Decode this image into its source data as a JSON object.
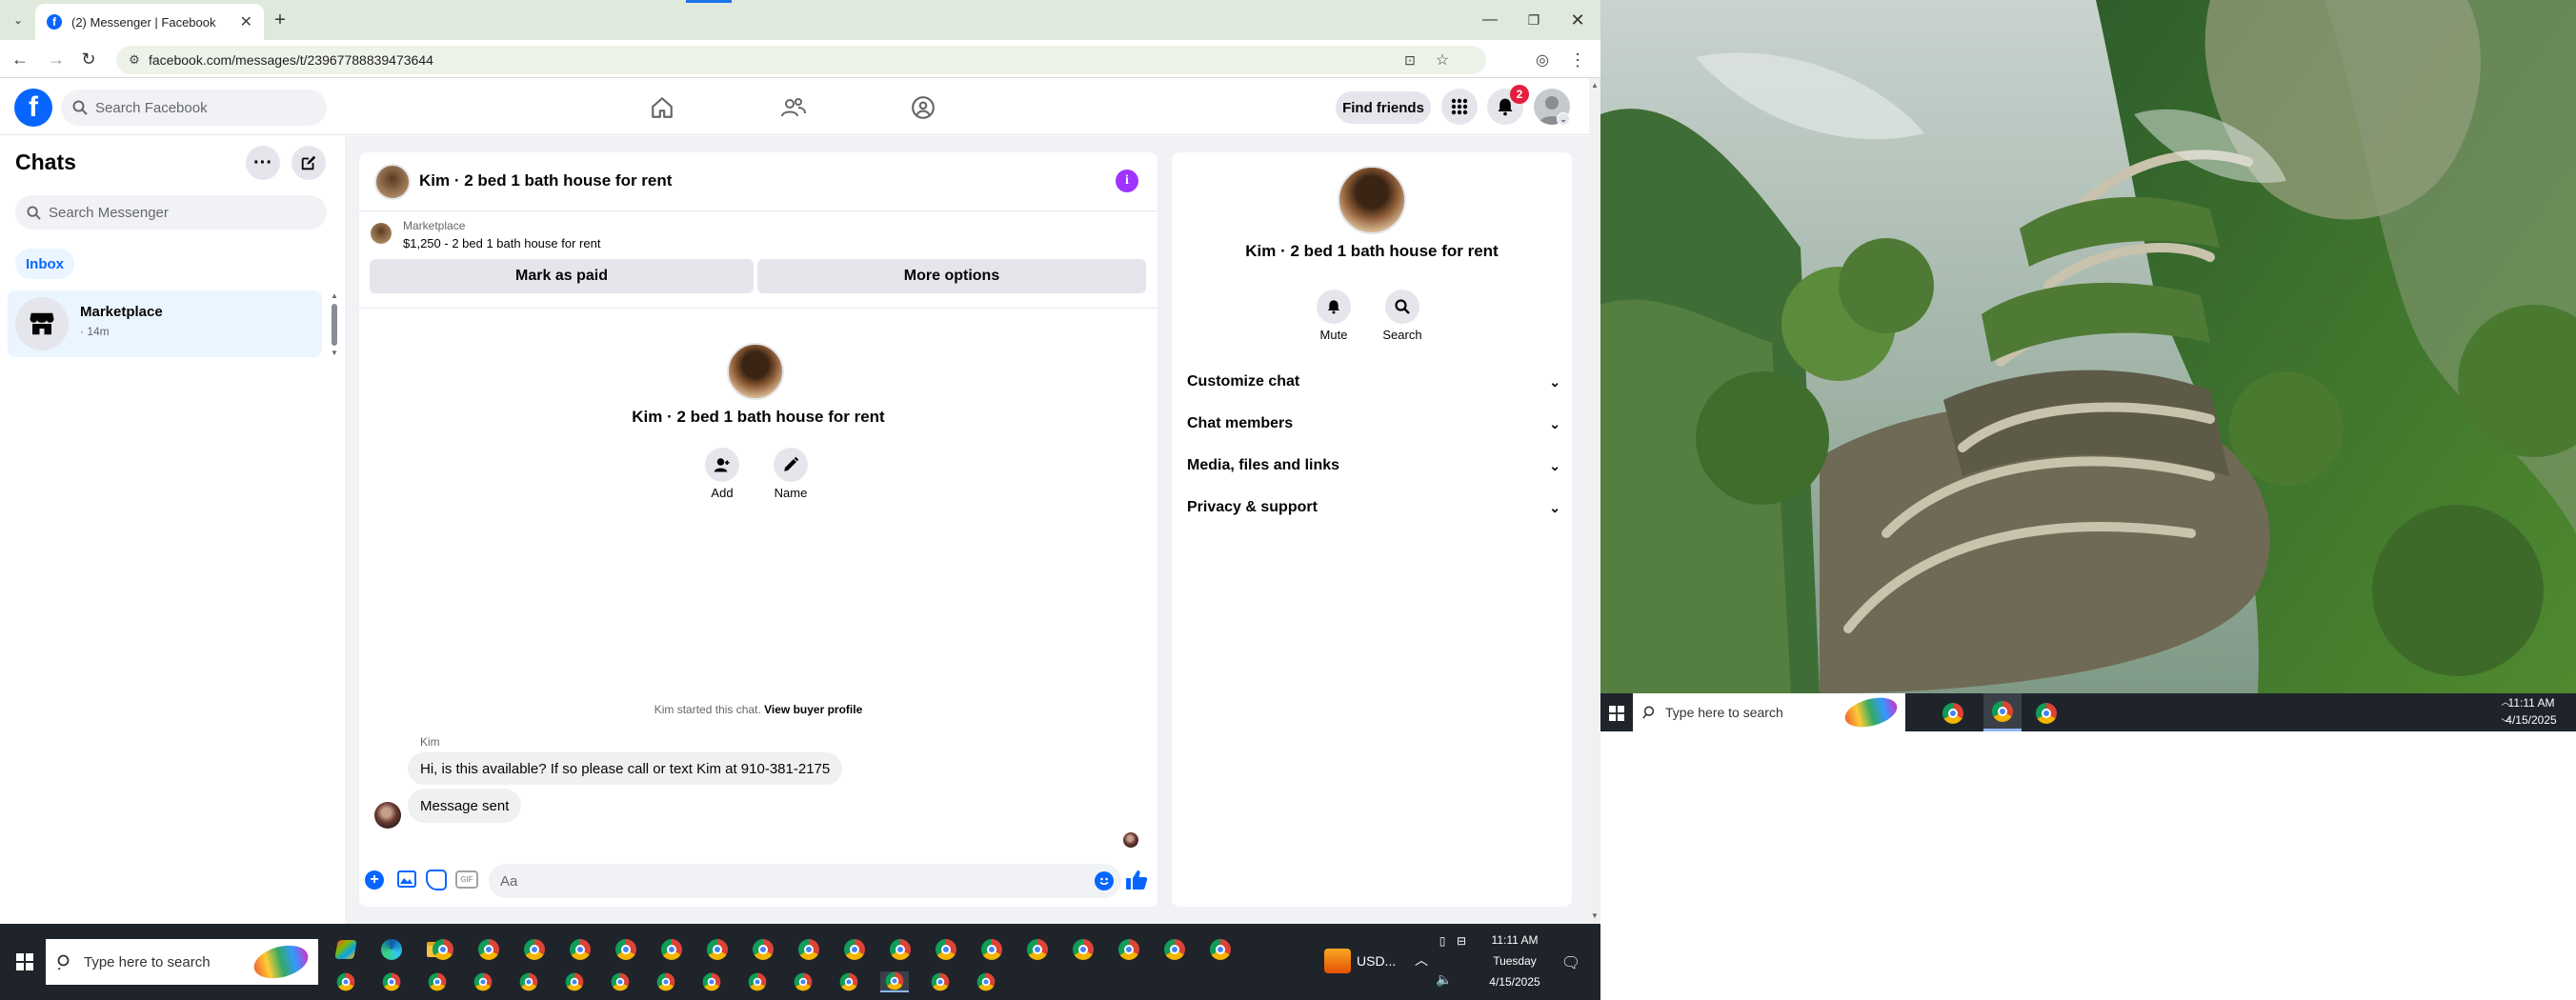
{
  "browser": {
    "tab_title": "(2) Messenger | Facebook",
    "url": "facebook.com/messages/t/23967788839473644"
  },
  "fb_header": {
    "search_placeholder": "Search Facebook",
    "find_friends": "Find friends",
    "notification_count": "2"
  },
  "sidebar": {
    "title": "Chats",
    "search_placeholder": "Search Messenger",
    "filter_inbox": "Inbox",
    "chats": [
      {
        "name": "Marketplace",
        "meta": "· 14m"
      }
    ]
  },
  "chat": {
    "header_title": "Kim · 2 bed 1 bath house for rent",
    "listing_source": "Marketplace",
    "listing_desc": "$1,250 - 2 bed 1 bath house for rent",
    "mark_paid": "Mark as paid",
    "more_options": "More options",
    "profile_name": "Kim · 2 bed 1 bath house for rent",
    "actions": [
      {
        "label": "Add",
        "icon": "add-person-icon"
      },
      {
        "label": "Name",
        "icon": "pencil-icon"
      }
    ],
    "started_text": "Kim started this chat.",
    "view_buyer": "View buyer profile",
    "sender": "Kim",
    "messages": [
      "Hi, is this available? If so please call or text Kim at 910-381-2175",
      "Message sent"
    ],
    "composer_placeholder": "Aa"
  },
  "info_panel": {
    "name": "Kim · 2 bed 1 bath house for rent",
    "mute": "Mute",
    "search": "Search",
    "sections": [
      "Customize chat",
      "Chat members",
      "Media, files and links",
      "Privacy & support"
    ]
  },
  "taskbar": {
    "search_placeholder": "Type here to search",
    "currency": "USD...",
    "time": "11:11 AM",
    "day": "Tuesday",
    "date": "4/15/2025"
  },
  "desktop_taskbar": {
    "search_placeholder": "Type here to search",
    "time": "11:11 AM",
    "date": "4/15/2025"
  },
  "colors": {
    "fb_blue": "#0866ff",
    "accent_purple": "#a033ff",
    "badge_red": "#e41e3f"
  }
}
